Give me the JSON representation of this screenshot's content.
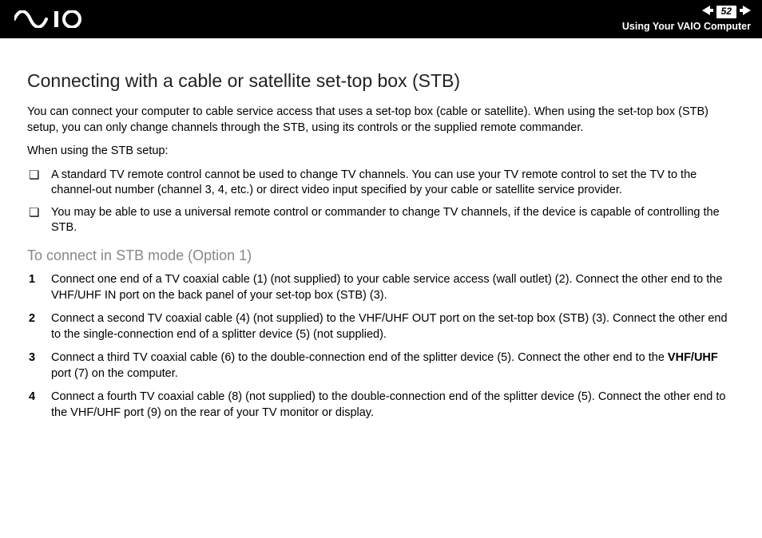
{
  "header": {
    "page_number": "52",
    "section_label": "Using Your VAIO Computer"
  },
  "content": {
    "title": "Connecting with a cable or satellite set-top box (STB)",
    "intro1": "You can connect your computer to cable service access that uses a set-top box (cable or satellite). When using the set-top box (STB) setup, you can only change channels through the STB, using its controls or the supplied remote commander.",
    "intro2": "When using the STB setup:",
    "bullets": [
      "A standard TV remote control cannot be used to change TV channels. You can use your TV remote control to set the TV to the channel-out number (channel 3, 4, etc.) or direct video input specified by your cable or satellite service provider.",
      "You may be able to use a universal remote control or commander to change TV channels, if the device is capable of controlling the STB."
    ],
    "subheading": "To connect in STB mode (Option 1)",
    "steps": [
      {
        "num": "1",
        "text": "Connect one end of a TV coaxial cable (1) (not supplied) to your cable service access (wall outlet) (2). Connect the other end to the VHF/UHF IN port on the back panel of your set-top box (STB) (3)."
      },
      {
        "num": "2",
        "text": "Connect a second TV coaxial cable (4) (not supplied) to the VHF/UHF OUT port on the set-top box (STB) (3). Connect the other end to the single-connection end of a splitter device (5) (not supplied)."
      },
      {
        "num": "3",
        "text_pre": "Connect a third TV coaxial cable (6) to the double-connection end of the splitter device (5). Connect the other end to the ",
        "bold": "VHF/UHF",
        "text_post": " port (7) on the computer."
      },
      {
        "num": "4",
        "text": "Connect a fourth TV coaxial cable (8) (not supplied) to the double-connection end of the splitter device (5). Connect the other end to the VHF/UHF port (9) on the rear of your TV monitor or display."
      }
    ]
  }
}
